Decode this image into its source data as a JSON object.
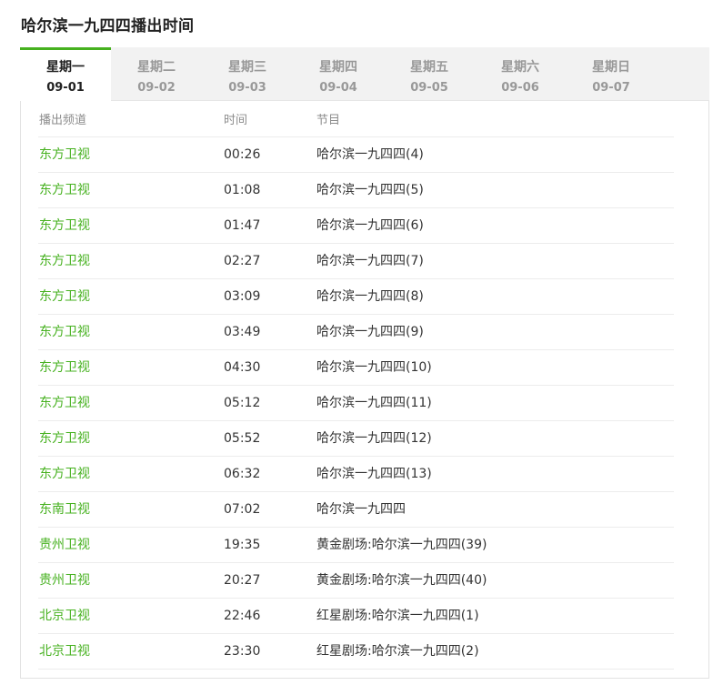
{
  "page": {
    "title": "哈尔滨一九四四播出时间"
  },
  "tabs": [
    {
      "day": "星期一",
      "date": "09-01",
      "active": true
    },
    {
      "day": "星期二",
      "date": "09-02",
      "active": false
    },
    {
      "day": "星期三",
      "date": "09-03",
      "active": false
    },
    {
      "day": "星期四",
      "date": "09-04",
      "active": false
    },
    {
      "day": "星期五",
      "date": "09-05",
      "active": false
    },
    {
      "day": "星期六",
      "date": "09-06",
      "active": false
    },
    {
      "day": "星期日",
      "date": "09-07",
      "active": false
    }
  ],
  "table": {
    "headers": {
      "channel": "播出频道",
      "time": "时间",
      "program": "节目"
    },
    "rows": [
      {
        "channel": "东方卫视",
        "time": "00:26",
        "program": "哈尔滨一九四四(4)"
      },
      {
        "channel": "东方卫视",
        "time": "01:08",
        "program": "哈尔滨一九四四(5)"
      },
      {
        "channel": "东方卫视",
        "time": "01:47",
        "program": "哈尔滨一九四四(6)"
      },
      {
        "channel": "东方卫视",
        "time": "02:27",
        "program": "哈尔滨一九四四(7)"
      },
      {
        "channel": "东方卫视",
        "time": "03:09",
        "program": "哈尔滨一九四四(8)"
      },
      {
        "channel": "东方卫视",
        "time": "03:49",
        "program": "哈尔滨一九四四(9)"
      },
      {
        "channel": "东方卫视",
        "time": "04:30",
        "program": "哈尔滨一九四四(10)"
      },
      {
        "channel": "东方卫视",
        "time": "05:12",
        "program": "哈尔滨一九四四(11)"
      },
      {
        "channel": "东方卫视",
        "time": "05:52",
        "program": "哈尔滨一九四四(12)"
      },
      {
        "channel": "东方卫视",
        "time": "06:32",
        "program": "哈尔滨一九四四(13)"
      },
      {
        "channel": "东南卫视",
        "time": "07:02",
        "program": "哈尔滨一九四四"
      },
      {
        "channel": "贵州卫视",
        "time": "19:35",
        "program": "黄金剧场:哈尔滨一九四四(39)"
      },
      {
        "channel": "贵州卫视",
        "time": "20:27",
        "program": "黄金剧场:哈尔滨一九四四(40)"
      },
      {
        "channel": "北京卫视",
        "time": "22:46",
        "program": "红星剧场:哈尔滨一九四四(1)"
      },
      {
        "channel": "北京卫视",
        "time": "23:30",
        "program": "红星剧场:哈尔滨一九四四(2)"
      }
    ]
  },
  "colors": {
    "accent": "#46b11f",
    "tab_bg": "#f2f2f2",
    "muted": "#999999",
    "border": "#ececec"
  }
}
